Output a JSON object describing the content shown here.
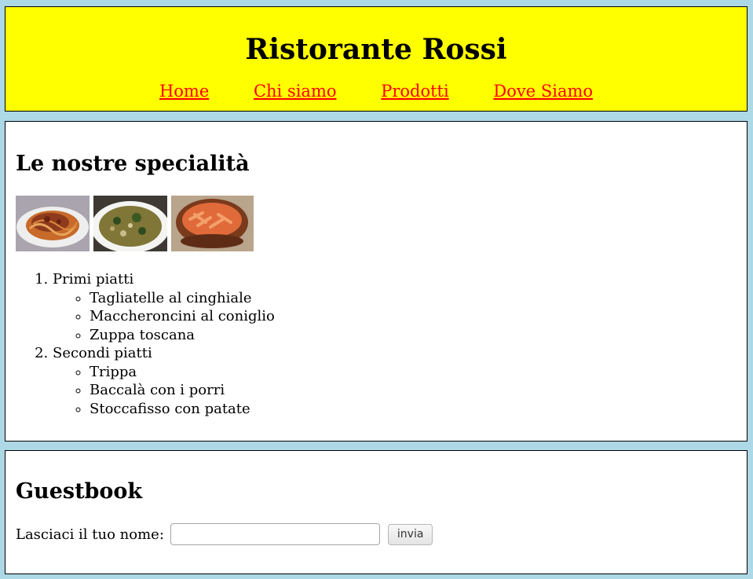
{
  "header": {
    "title": "Ristorante Rossi",
    "nav": [
      {
        "label": "Home"
      },
      {
        "label": "Chi siamo"
      },
      {
        "label": "Prodotti"
      },
      {
        "label": "Dove Siamo"
      }
    ]
  },
  "specialties": {
    "heading": "Le nostre specialità",
    "images": [
      {
        "name": "tagliatelle-photo"
      },
      {
        "name": "zuppa-photo"
      },
      {
        "name": "pasta-bowl-photo"
      }
    ],
    "categories": [
      {
        "label": "Primi piatti",
        "items": [
          "Tagliatelle al cinghiale",
          "Maccheroncini al coniglio",
          "Zuppa toscana"
        ]
      },
      {
        "label": "Secondi piatti",
        "items": [
          "Trippa",
          "Baccalà con i porri",
          "Stoccafisso con patate"
        ]
      }
    ]
  },
  "guestbook": {
    "heading": "Guestbook",
    "name_label": "Lasciaci il tuo nome:",
    "name_value": "",
    "submit_label": "invia"
  },
  "colors": {
    "page_background": "#add8e6",
    "header_background": "#ffff00",
    "link": "#ff0000"
  }
}
